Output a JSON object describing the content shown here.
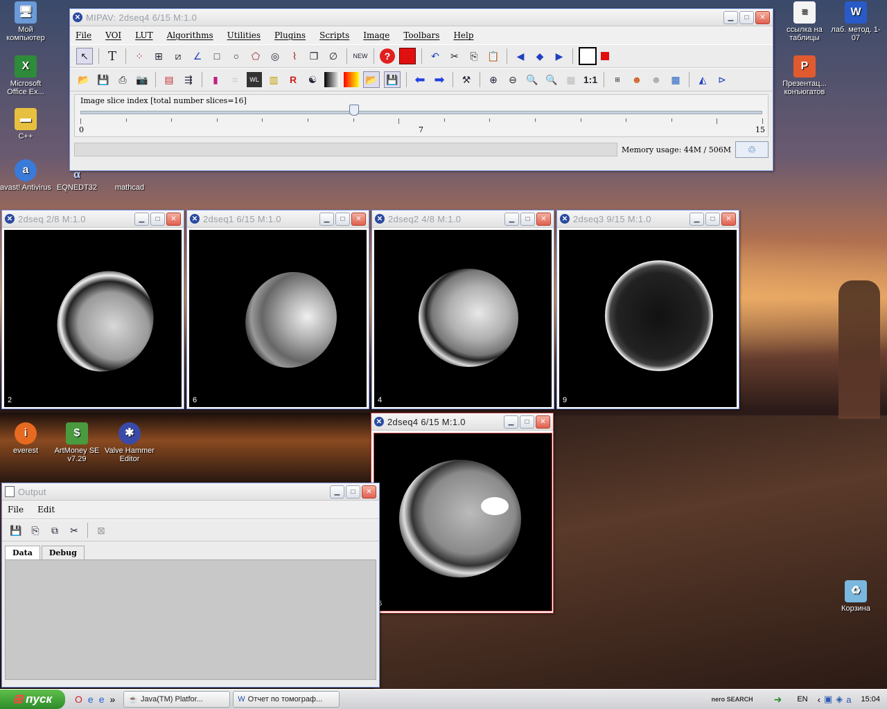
{
  "desktop": {
    "icons_left": [
      {
        "label": "Мой компьютер",
        "icon": "computer-icon"
      },
      {
        "label": "Microsoft Office Ex...",
        "icon": "excel-icon"
      },
      {
        "label": "C++",
        "icon": "folder-icon"
      },
      {
        "label": "avast! Antivirus",
        "icon": "avast-icon"
      },
      {
        "label": "EQNEDT32",
        "icon": "equation-icon"
      },
      {
        "label": "mathcad",
        "icon": "mathcad-icon"
      },
      {
        "label": "everest",
        "icon": "everest-icon"
      },
      {
        "label": "ArtMoney SE v7.29",
        "icon": "artmoney-icon"
      },
      {
        "label": "Valve Hammer Editor",
        "icon": "hammer-icon"
      }
    ],
    "icons_right": [
      {
        "label": "ссылка на таблицы",
        "icon": "document-icon"
      },
      {
        "label": "лаб. метод. 1-07",
        "icon": "word-icon"
      },
      {
        "label": "Презентац... конъюгатов",
        "icon": "powerpoint-icon"
      },
      {
        "label": "Корзина",
        "icon": "recycle-bin-icon"
      }
    ]
  },
  "main_window": {
    "title": "MIPAV:  2dseq4   6/15 M:1.0",
    "menu": [
      "File",
      "VOI",
      "LUT",
      "Algorithms",
      "Utilities",
      "Plugins",
      "Scripts",
      "Image",
      "Toolbars",
      "Help"
    ],
    "slider": {
      "label": "Image slice index  [total number slices=16]",
      "min_label": "0",
      "mid_label": "7",
      "max_label": "15",
      "value": 6,
      "min": 0,
      "max": 15
    },
    "memory_label": "Memory usage: 44M / 506M"
  },
  "image_windows": [
    {
      "title": "2dseq   2/8 M:1.0",
      "slice": "2"
    },
    {
      "title": "2dseq1   6/15 M:1.0",
      "slice": "6"
    },
    {
      "title": "2dseq2   4/8 M:1.0",
      "slice": "4"
    },
    {
      "title": "2dseq3   9/15 M:1.0",
      "slice": "9"
    },
    {
      "title": "2dseq4   6/15 M:1.0",
      "slice": "6"
    }
  ],
  "output_window": {
    "title": "Output",
    "menu": [
      "File",
      "Edit"
    ],
    "tabs": [
      "Data",
      "Debug"
    ]
  },
  "taskbar": {
    "start_label": "пуск",
    "tasks": [
      "Java(TM) Platfor...",
      "Отчет по томограф..."
    ],
    "search_label": "nero SEARCH",
    "lang": "EN",
    "clock": "15:04"
  }
}
